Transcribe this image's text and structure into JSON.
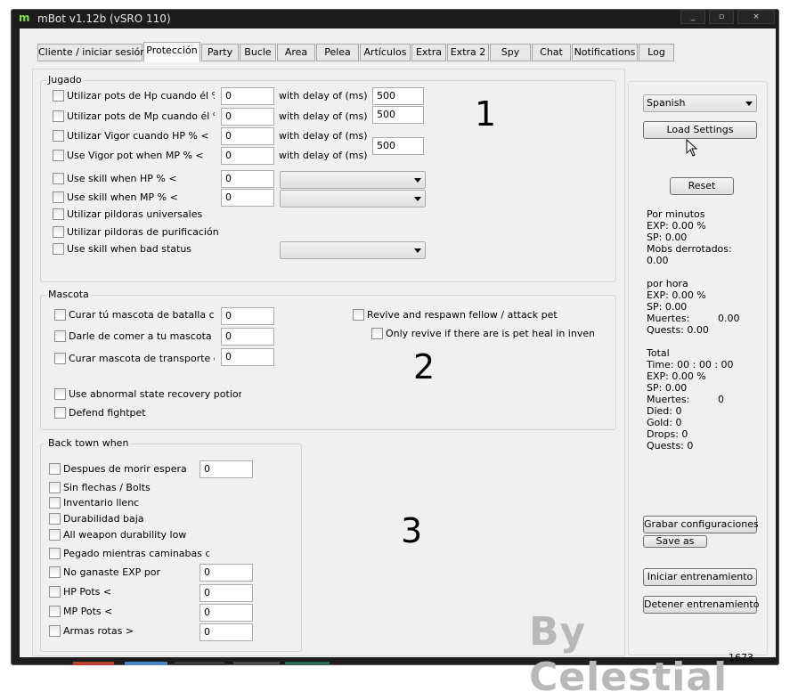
{
  "window": {
    "title": "mBot v1.12b (vSRO 110)",
    "icon": "m",
    "minimize": "_",
    "maximize": "▫",
    "close": "×"
  },
  "tabs": [
    "Cliente / iniciar sesión",
    "Protección",
    "Party",
    "Bucle",
    "Area",
    "Pelea",
    "Artículos",
    "Extra",
    "Extra 2",
    "Spy",
    "Chat",
    "Notifications",
    "Log"
  ],
  "jugado": {
    "title": "Jugado",
    "hp_pots": {
      "label": "Utilizar pots de Hp cuando él % de",
      "value": "0",
      "delay_label": "with delay of (ms)",
      "delay": "500"
    },
    "mp_pots": {
      "label": "Utilizar pots de Mp cuando él % de",
      "value": "0",
      "delay_label": "with delay of (ms)",
      "delay": "500"
    },
    "vigor_hp": {
      "label": "Utilizar Vigor cuando HP % <",
      "value": "0",
      "delay_label": "with delay of (ms)"
    },
    "vigor_mp": {
      "label": "Use Vigor pot when MP % <",
      "value": "0",
      "delay_label": "with delay of (ms)",
      "delay": "500"
    },
    "skill_hp": {
      "label": "Use skill when HP % <",
      "value": "0"
    },
    "skill_mp": {
      "label": "Use skill when MP % <",
      "value": "0"
    },
    "universal": "Utilizar pildoras universales",
    "purification": "Utilizar pildoras de purificación",
    "bad_status": "Use skill when bad status"
  },
  "mascota": {
    "title": "Mascota",
    "cure_battle": {
      "label": "Curar tú mascota de batalla cuando",
      "value": "0"
    },
    "feed": {
      "label": "Darle de comer a tu mascota de ba",
      "value": "0"
    },
    "cure_transport": {
      "label": "Curar mascota de transporte cuar",
      "value": "0"
    },
    "revive": "Revive and respawn fellow / attack pet",
    "only_revive": "Only revive if there are is pet heal in inventory",
    "abnormal": "Use abnormal state recovery potion",
    "defend": "Defend fightpet"
  },
  "backtown": {
    "title": "Back town when",
    "after_death": {
      "label": "Despues de morir espera",
      "value": "0"
    },
    "no_arrows": "Sin flechas / Bolts",
    "inventory_full": "Inventario llenc",
    "low_durability": "Durabilidad baja",
    "all_weapon": "All weapon durability low",
    "stuck": "Pegado mientras caminabas de vu",
    "no_exp": {
      "label": "No ganaste EXP por",
      "value": "0"
    },
    "hp_pots": {
      "label": "HP Pots <",
      "value": "0"
    },
    "mp_pots": {
      "label": "MP Pots <",
      "value": "0"
    },
    "broken": {
      "label": "Armas rotas >",
      "value": "0"
    }
  },
  "annotations": [
    "1",
    "2",
    "3"
  ],
  "side": {
    "language": "Spanish",
    "load_settings": "Load Settings",
    "reset": "Reset",
    "per_minute": {
      "title": "Por minutos",
      "exp": "EXP:     0.00 %",
      "sp": "SP:        0.00",
      "mobs": "Mobs derrotados:",
      "mobs_value": "0.00"
    },
    "per_hour": {
      "title": "por hora",
      "exp": "EXP:     0.00 %",
      "sp": "SP:        0.00",
      "deaths": "Muertes:",
      "deaths_value": "0.00",
      "quests": "Quests: 0.00"
    },
    "total": {
      "title": "Total",
      "time": "Time:     00 : 00 : 00",
      "exp": "EXP:     0.00 %",
      "sp": "SP:        0.00",
      "deaths": "Muertes:",
      "deaths_value": "0",
      "died": "Died:    0",
      "gold": "Gold:    0",
      "drops": "Drops:   0",
      "quests": "Quests: 0"
    },
    "save_config": "Grabar configuraciones",
    "save_as": "Save as",
    "start": "Iniciar entrenamiento",
    "stop": "Detener entrenamiento"
  },
  "watermark": "By Celestial",
  "status_number": "1673"
}
